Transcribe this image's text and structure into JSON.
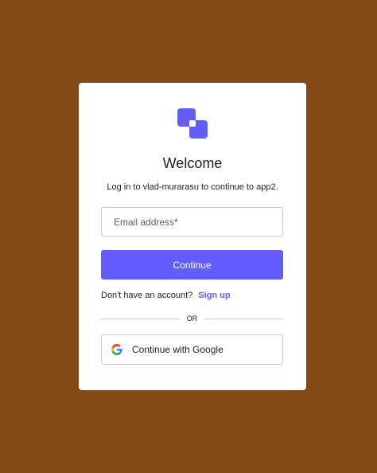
{
  "colors": {
    "page_background": "#834a17",
    "card_background": "#ffffff",
    "accent": "#635dff",
    "text": "#1e212a"
  },
  "logo": {
    "icon": "overlapping-squares-logo-icon"
  },
  "header": {
    "title": "Welcome",
    "subtitle": "Log in to vlad-murarasu to continue to app2."
  },
  "form": {
    "email": {
      "value": "",
      "placeholder": "Email address*"
    },
    "continue_label": "Continue"
  },
  "signup": {
    "prompt": "Don't have an account?",
    "link_label": "Sign up"
  },
  "divider": {
    "label": "OR"
  },
  "social": {
    "google_label": "Continue with Google",
    "google_icon": "google-icon"
  }
}
